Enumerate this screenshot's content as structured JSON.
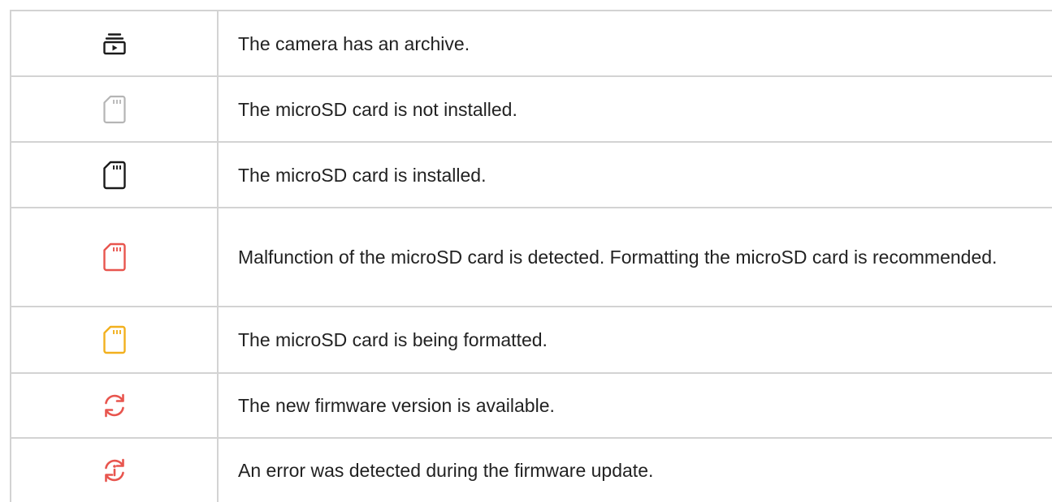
{
  "colors": {
    "border": "#d3d3d3",
    "black": "#1a1a1a",
    "gray": "#b5b5b5",
    "red": "#e8554e",
    "yellow": "#f2b01e"
  },
  "rows": [
    {
      "icon": "archive-icon",
      "icon_color": "#1a1a1a",
      "text": "The camera has an archive."
    },
    {
      "icon": "sd-card-not-installed-icon",
      "icon_color": "#b5b5b5",
      "text": "The microSD card is not installed."
    },
    {
      "icon": "sd-card-installed-icon",
      "icon_color": "#1a1a1a",
      "text": "The microSD card is installed."
    },
    {
      "icon": "sd-card-malfunction-icon",
      "icon_color": "#e8554e",
      "text": "Malfunction of the microSD card is detected. Formatting the microSD card is recommended."
    },
    {
      "icon": "sd-card-formatting-icon",
      "icon_color": "#f2b01e",
      "text": "The microSD card is being formatted."
    },
    {
      "icon": "firmware-update-icon",
      "icon_color": "#e8554e",
      "text": "The new firmware version is available."
    },
    {
      "icon": "firmware-error-icon",
      "icon_color": "#e8554e",
      "text": "An error was detected during the firmware update."
    }
  ]
}
